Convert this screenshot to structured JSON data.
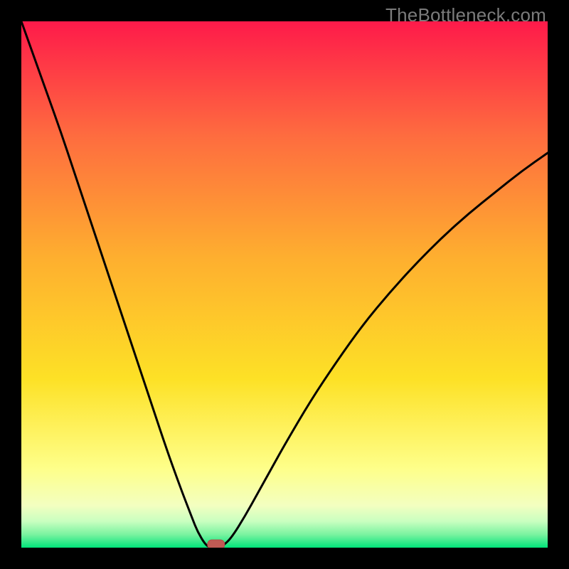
{
  "watermark": "TheBottleneck.com",
  "colors": {
    "frame": "#000000",
    "gradient_top": "#fe1a4a",
    "gradient_mid_upper": "#fe8b3a",
    "gradient_mid": "#fde126",
    "gradient_lower": "#feff8a",
    "gradient_pale": "#e8ffd6",
    "gradient_bottom": "#00e47a",
    "curve": "#000000",
    "marker_fill": "#c15a54",
    "marker_stroke": "#b24f49"
  },
  "chart_data": {
    "type": "line",
    "title": "",
    "xlabel": "",
    "ylabel": "",
    "xlim": [
      0,
      100
    ],
    "ylim": [
      0,
      100
    ],
    "series": [
      {
        "name": "bottleneck-curve",
        "x": [
          0,
          2.5,
          5,
          7.5,
          10,
          12.5,
          15,
          17.5,
          20,
          22.5,
          25,
          27.5,
          30,
          32.5,
          33.5,
          35,
          36,
          37.5,
          38.5,
          40,
          42.5,
          45,
          47.5,
          50,
          55,
          60,
          65,
          70,
          75,
          80,
          85,
          90,
          95,
          100
        ],
        "y": [
          100,
          93,
          86,
          79,
          71.5,
          64,
          56.5,
          49,
          41.5,
          34,
          26.5,
          19,
          12,
          5.5,
          3,
          0.5,
          0,
          0,
          0.5,
          2,
          6,
          10.5,
          15,
          19.5,
          28,
          35.5,
          42.5,
          48.5,
          54,
          59,
          63.5,
          67.5,
          71.5,
          75
        ]
      }
    ],
    "annotations": [
      {
        "name": "min-marker",
        "x": 37,
        "y": 0
      }
    ],
    "legend": null,
    "grid": false
  }
}
